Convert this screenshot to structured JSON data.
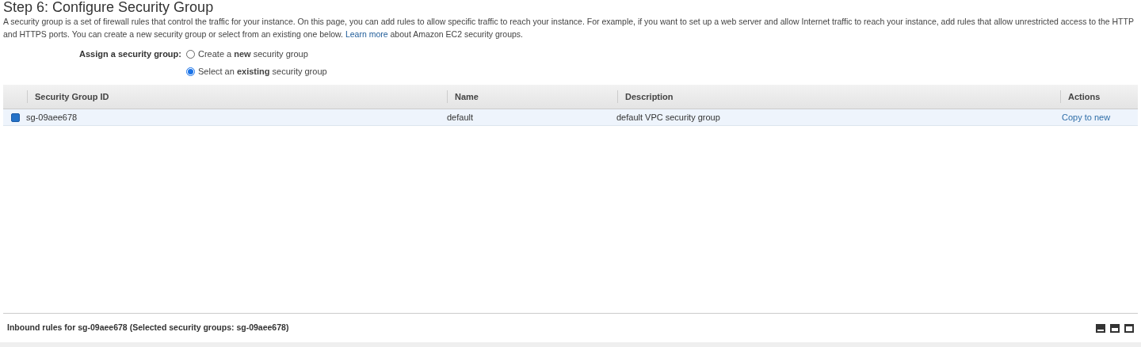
{
  "title": "Step 6: Configure Security Group",
  "intro": {
    "before": "A security group is a set of firewall rules that control the traffic for your instance. On this page, you can add rules to allow specific traffic to reach your instance. For example, if you want to set up a web server and allow Internet traffic to reach your instance, add rules that allow unrestricted access to the HTTP and HTTPS ports. You can create a new security group or select from an existing one below.",
    "link": "Learn more",
    "after": "about Amazon EC2 security groups."
  },
  "assign": {
    "label": "Assign a security group:",
    "options": [
      {
        "label": "Create a **new** security group",
        "selected": false
      },
      {
        "label": "Select an **existing** security group",
        "selected": true
      }
    ]
  },
  "table": {
    "columns": [
      "Security Group ID",
      "Name",
      "Description",
      "Actions"
    ],
    "rows": [
      {
        "selected": true,
        "id": "sg-09aee678",
        "name": "default",
        "description": "default VPC security group",
        "action": "Copy to new"
      }
    ]
  },
  "bottom_panel": {
    "title": "Inbound rules for sg-09aee678 (Selected security groups: sg-09aee678)"
  }
}
